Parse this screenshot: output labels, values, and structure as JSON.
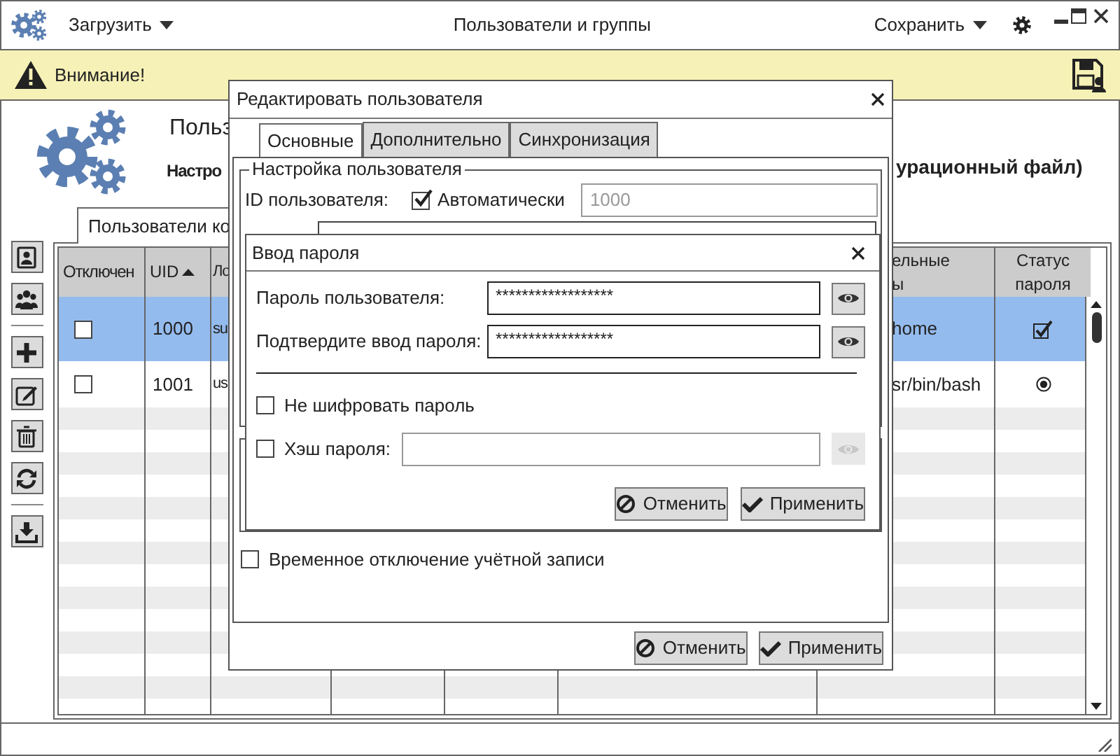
{
  "window": {
    "title": "Пользователи и группы",
    "menus": [
      {
        "label": "Загрузить"
      },
      {
        "label": "Сохранить"
      }
    ]
  },
  "warning": {
    "text": "Внимание!"
  },
  "header": {
    "title": "Польз",
    "subtitle": "Настро",
    "subtitle_tail": "урационный файл)"
  },
  "tabs": [
    {
      "label": "Пользователи ко",
      "selected": true
    }
  ],
  "table": {
    "columns": [
      {
        "label": "Отключен"
      },
      {
        "label": "UID",
        "sort_ascending": true
      },
      {
        "label": "Ло"
      },
      {
        "label_lines": [
          "ельные",
          "ы"
        ]
      },
      {
        "label": "Статус пароля"
      }
    ],
    "rows": [
      {
        "selected": true,
        "disabled": false,
        "uid": "1000",
        "login": "su",
        "column_7": "home",
        "status_cell": {
          "kind": "check"
        }
      },
      {
        "selected": false,
        "disabled": false,
        "uid": "1001",
        "login": "us",
        "column_7": "sr/bin/bash",
        "status_cell": {
          "kind": "dot"
        }
      }
    ]
  },
  "edit_dialog": {
    "title": "Редактировать пользователя",
    "tabs": [
      {
        "label": "Основные",
        "selected": true
      },
      {
        "label": "Дополнительно",
        "selected": false
      },
      {
        "label": "Синхронизация",
        "selected": false
      }
    ],
    "group_title": "Настройка пользователя",
    "uid_label": "ID пользователя:",
    "auto": {
      "label": "Автоматически",
      "checked": true
    },
    "uid_value": "1000",
    "lock": {
      "label": "Временное отключение учётной записи",
      "checked": false
    },
    "buttons": [
      {
        "kind": "cancel",
        "label": "Отменить"
      },
      {
        "kind": "apply",
        "label": "Применить"
      }
    ]
  },
  "password_dialog": {
    "title": "Ввод пароля",
    "fields": [
      {
        "label": "Пароль пользователя:",
        "value": "******************"
      },
      {
        "label": "Подтвердите ввод пароля:",
        "value": "******************"
      }
    ],
    "no_encrypt": {
      "label": "Не шифровать пароль",
      "checked": false
    },
    "hash": {
      "label": "Хэш пароля:",
      "checked": false
    },
    "buttons": [
      {
        "kind": "cancel",
        "label": "Отменить"
      },
      {
        "kind": "apply",
        "label": "Применить"
      }
    ]
  }
}
